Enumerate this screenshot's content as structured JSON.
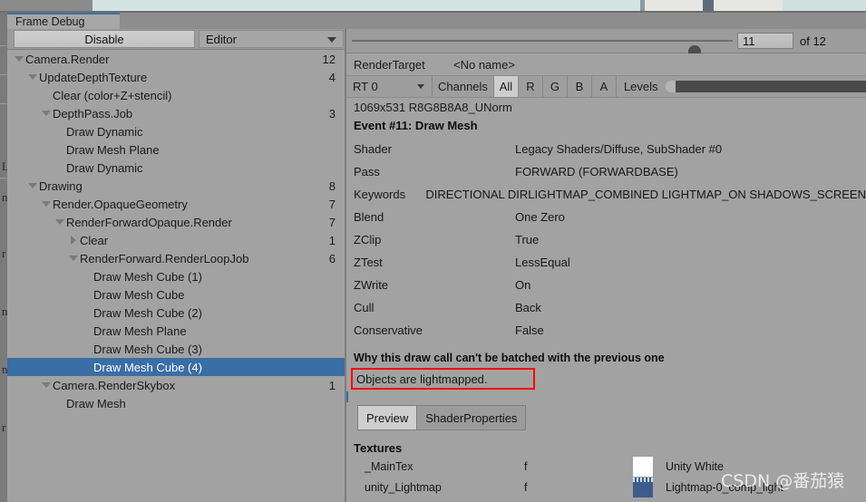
{
  "window": {
    "tab_label": "Frame Debug"
  },
  "left_toolbar": {
    "disable_label": "Disable",
    "target_dropdown_value": "Editor",
    "dropdown_icon": "chevron-down-icon"
  },
  "tree": {
    "rows": [
      {
        "indent": 0,
        "toggle": "down",
        "label": "Camera.Render",
        "count": "12",
        "selected": false
      },
      {
        "indent": 1,
        "toggle": "down",
        "label": "UpdateDepthTexture",
        "count": "4",
        "selected": false
      },
      {
        "indent": 2,
        "toggle": "none",
        "label": "Clear (color+Z+stencil)",
        "count": "",
        "selected": false
      },
      {
        "indent": 2,
        "toggle": "down",
        "label": "DepthPass.Job",
        "count": "3",
        "selected": false
      },
      {
        "indent": 3,
        "toggle": "none",
        "label": "Draw Dynamic",
        "count": "",
        "selected": false
      },
      {
        "indent": 3,
        "toggle": "none",
        "label": "Draw Mesh Plane",
        "count": "",
        "selected": false
      },
      {
        "indent": 3,
        "toggle": "none",
        "label": "Draw Dynamic",
        "count": "",
        "selected": false
      },
      {
        "indent": 1,
        "toggle": "down",
        "label": "Drawing",
        "count": "8",
        "selected": false
      },
      {
        "indent": 2,
        "toggle": "down",
        "label": "Render.OpaqueGeometry",
        "count": "7",
        "selected": false
      },
      {
        "indent": 3,
        "toggle": "down",
        "label": "RenderForwardOpaque.Render",
        "count": "7",
        "selected": false
      },
      {
        "indent": 4,
        "toggle": "right",
        "label": "Clear",
        "count": "1",
        "selected": false
      },
      {
        "indent": 4,
        "toggle": "down",
        "label": "RenderForward.RenderLoopJob",
        "count": "6",
        "selected": false
      },
      {
        "indent": 5,
        "toggle": "none",
        "label": "Draw Mesh Cube (1)",
        "count": "",
        "selected": false
      },
      {
        "indent": 5,
        "toggle": "none",
        "label": "Draw Mesh Cube",
        "count": "",
        "selected": false
      },
      {
        "indent": 5,
        "toggle": "none",
        "label": "Draw Mesh Cube (2)",
        "count": "",
        "selected": false
      },
      {
        "indent": 5,
        "toggle": "none",
        "label": "Draw Mesh Plane",
        "count": "",
        "selected": false
      },
      {
        "indent": 5,
        "toggle": "none",
        "label": "Draw Mesh Cube (3)",
        "count": "",
        "selected": false
      },
      {
        "indent": 5,
        "toggle": "none",
        "label": "Draw Mesh Cube (4)",
        "count": "",
        "selected": true
      },
      {
        "indent": 2,
        "toggle": "down",
        "label": "Camera.RenderSkybox",
        "count": "1",
        "selected": false
      },
      {
        "indent": 3,
        "toggle": "none",
        "label": "Draw Mesh",
        "count": "",
        "selected": false
      }
    ]
  },
  "event_nav": {
    "current_event": "11",
    "of_label": "of 12",
    "slider_position_pct": 90
  },
  "render_target": {
    "label": "RenderTarget",
    "name": "<No name>",
    "rt_select": "RT 0",
    "channels_label": "Channels",
    "channels": [
      {
        "label": "All",
        "active": true
      },
      {
        "label": "R",
        "active": false
      },
      {
        "label": "G",
        "active": false
      },
      {
        "label": "B",
        "active": false
      },
      {
        "label": "A",
        "active": false
      }
    ],
    "levels_label": "Levels",
    "dimensions": "1069x531 R8G8B8A8_UNorm",
    "event_title": "Event #11: Draw Mesh"
  },
  "properties": [
    {
      "key": "Shader",
      "value": "Legacy Shaders/Diffuse, SubShader #0"
    },
    {
      "key": "Pass",
      "value": "FORWARD (FORWARDBASE)"
    },
    {
      "key": "Keywords",
      "value": "DIRECTIONAL DIRLIGHTMAP_COMBINED LIGHTMAP_ON SHADOWS_SCREEN"
    },
    {
      "key": "Blend",
      "value": "One Zero"
    },
    {
      "key": "ZClip",
      "value": "True"
    },
    {
      "key": "ZTest",
      "value": "LessEqual"
    },
    {
      "key": "ZWrite",
      "value": "On"
    },
    {
      "key": "Cull",
      "value": "Back"
    },
    {
      "key": "Conservative",
      "value": "False"
    }
  ],
  "batching": {
    "title": "Why this draw call can't be batched with the previous one",
    "reason": "Objects are lightmapped.",
    "highlight_color": "#ff0000"
  },
  "preview_tabs": [
    {
      "label": "Preview",
      "active": true
    },
    {
      "label": "ShaderProperties",
      "active": false
    }
  ],
  "textures": {
    "title": "Textures",
    "rows": [
      {
        "name": "_MainTex",
        "flag": "f",
        "swatch": "white",
        "value": "Unity White"
      },
      {
        "name": "unity_Lightmap",
        "flag": "f",
        "swatch": "lightmap",
        "value": "Lightmap-0_comp_light"
      }
    ]
  },
  "watermark": {
    "text": "CSDN @番茄猿"
  },
  "colors": {
    "selection": "#3a6ea5",
    "panel": "#a2a2a2",
    "chrome": "#9a9a9a"
  }
}
